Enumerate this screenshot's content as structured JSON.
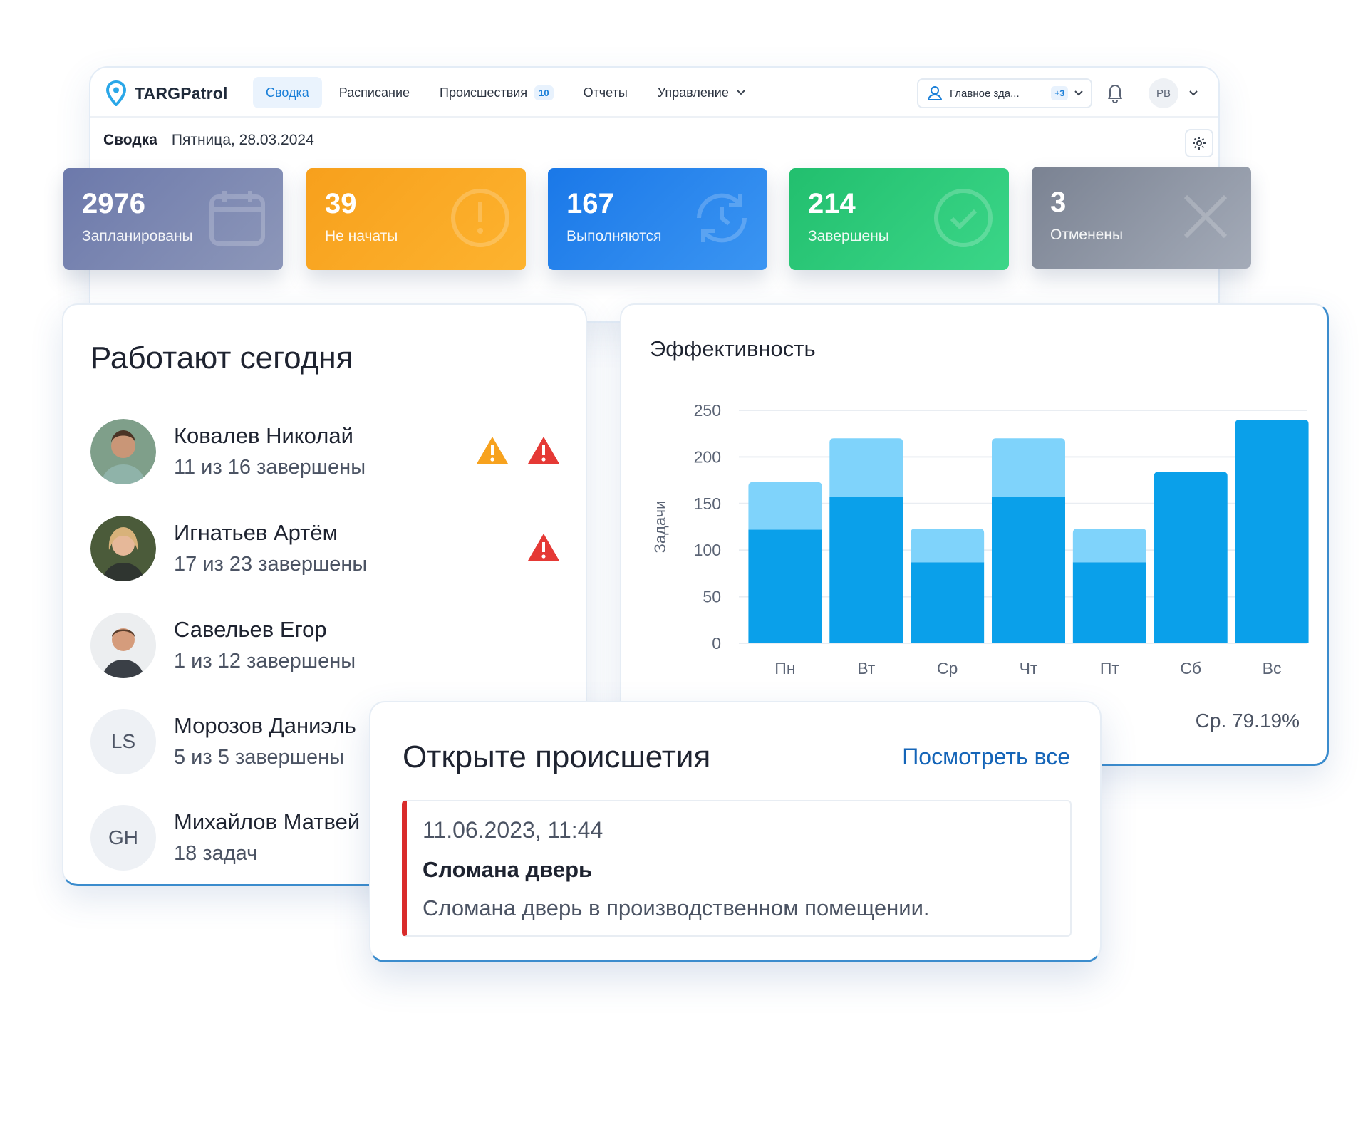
{
  "app": {
    "name": "TARGPatrol",
    "nav": [
      {
        "label": "Сводка",
        "active": true
      },
      {
        "label": "Расписание"
      },
      {
        "label": "Происшествия",
        "badge": "10"
      },
      {
        "label": "Отчеты"
      },
      {
        "label": "Управление",
        "dropdown": true
      }
    ],
    "location": {
      "label": "Главное зда...",
      "count": "+3"
    },
    "user_initials": "PB"
  },
  "breadcrumb": {
    "title": "Сводка",
    "date": "Пятница, 28.03.2024"
  },
  "stats": [
    {
      "value": "2976",
      "label": "Запланированы",
      "color": "#6773a3",
      "icon": "calendar-icon"
    },
    {
      "value": "39",
      "label": "Не начаты",
      "color": "#f7a21e",
      "icon": "alert-circle-icon"
    },
    {
      "value": "167",
      "label": "Выполняются",
      "color": "#2080ec",
      "icon": "clock-refresh-icon"
    },
    {
      "value": "214",
      "label": "Завершены",
      "color": "#2cc474",
      "icon": "check-circle-icon"
    },
    {
      "value": "3",
      "label": "Отменены",
      "color": "#7e8696",
      "icon": "x-icon"
    }
  ],
  "today": {
    "title": "Работают сегодня",
    "workers": [
      {
        "name": "Ковалев Николай",
        "progress": "11 из 16 завершены",
        "avatar": "photo",
        "warnings": [
          "orange",
          "red"
        ]
      },
      {
        "name": "Игнатьев Артём",
        "progress": "17 из 23 завершены",
        "avatar": "photo",
        "warnings": [
          "red"
        ]
      },
      {
        "name": "Савельев Егор",
        "progress": "1 из 12 завершены",
        "avatar": "photo",
        "warnings": []
      },
      {
        "name": "Морозов Даниэль",
        "progress": "5 из 5 завершены",
        "avatar": "LS",
        "warnings": []
      },
      {
        "name": "Михайлов Матвей",
        "progress": "18 задач",
        "avatar": "GH",
        "warnings": []
      }
    ]
  },
  "chart_data": {
    "type": "bar",
    "title": "Эффективность",
    "ylabel": "Задачи",
    "xlabel": "",
    "categories": [
      "Пн",
      "Вт",
      "Ср",
      "Чт",
      "Пт",
      "Сб",
      "Вс"
    ],
    "series": [
      {
        "values": [
          122,
          157,
          87,
          157,
          87,
          184,
          240
        ],
        "color": "#0aa0ea"
      },
      {
        "values": [
          51,
          63,
          36,
          63,
          36,
          0,
          0
        ],
        "color": "#7fd3fb"
      }
    ],
    "stacked": true,
    "ylim": [
      0,
      250
    ],
    "yticks": [
      0,
      50,
      100,
      150,
      200,
      250
    ],
    "grid": true,
    "average": "Ср. 79.19%"
  },
  "incidents": {
    "title": "Открыте происшетия",
    "view_all": "Посмотреть все",
    "items": [
      {
        "datetime": "11.06.2023, 11:44",
        "title": "Сломана дверь",
        "description": "Сломана дверь в производственном помещении."
      }
    ]
  }
}
